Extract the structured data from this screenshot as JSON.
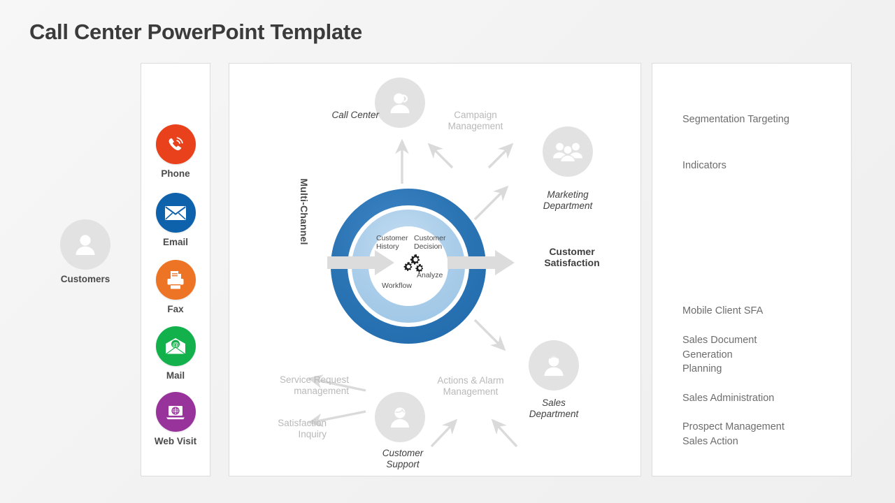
{
  "page": {
    "title": "Call Center PowerPoint Template",
    "background_color": "#f4f4f4",
    "panel_border_color": "#dcdcdc"
  },
  "customers": {
    "label": "Customers",
    "icon": "person-avatar-icon"
  },
  "channels": {
    "vertical_label": "Multi-Channel",
    "items": [
      {
        "label": "Phone",
        "icon": "phone-ringing-icon",
        "color": "#e8411b"
      },
      {
        "label": "Email",
        "icon": "envelope-icon",
        "color": "#0e62ab"
      },
      {
        "label": "Fax",
        "icon": "printer-fax-icon",
        "color": "#ec7424"
      },
      {
        "label": "Mail",
        "icon": "at-envelope-icon",
        "color": "#13b14b"
      },
      {
        "label": "Web Visit",
        "icon": "laptop-globe-icon",
        "color": "#99339c"
      }
    ]
  },
  "diagram": {
    "ring": {
      "outer_color": "#2b74b4",
      "inner_color": "#a8cce9",
      "core_words": [
        "Customer History",
        "Customer Decision",
        "Analyze",
        "Workflow"
      ],
      "word_history": "Customer History",
      "word_decision": "Customer Decision",
      "word_analyze": "Analyze",
      "word_workflow": "Workflow",
      "gears_icon": "gears-icon",
      "arrow_in_icon": "block-arrow-right-icon",
      "arrow_out_icon": "block-arrow-right-icon"
    },
    "nodes": {
      "call_center": {
        "label": "Call Center",
        "icon": "headset-agent-icon"
      },
      "campaign_management": {
        "label": "Campaign\nManagement"
      },
      "campaign_line1": "Campaign",
      "campaign_line2": "Management",
      "marketing_department": {
        "label": "Marketing\nDepartment",
        "icon": "people-group-icon"
      },
      "marketing_line1": "Marketing",
      "marketing_line2": "Department",
      "customer_satisfaction": {
        "line1": "Customer",
        "line2": "Satisfaction"
      },
      "sales_department": {
        "icon": "person-avatar-icon"
      },
      "sales_line1": "Sales",
      "sales_line2": "Department",
      "customer_support": {
        "icon": "support-agent-icon"
      },
      "support_line1": "Customer",
      "support_line2": "Support",
      "actions_line1": "Actions & Alarm",
      "actions_line2": "Management",
      "service_line1": "Service  Request",
      "service_line2": "management",
      "inquiry_line1": "Satisfaction",
      "inquiry_line2": "Inquiry"
    }
  },
  "right_panel": {
    "items": [
      "Segmentation Targeting",
      "Indicators",
      "Mobile Client SFA",
      "Sales Document\nGeneration\nPlanning",
      "Sales Administration",
      "Prospect Management\nSales Action"
    ],
    "item_0": "Segmentation Targeting",
    "item_1": "Indicators",
    "item_2": "Mobile Client SFA",
    "item_3_l1": "Sales Document",
    "item_3_l2": "Generation",
    "item_3_l3": "Planning",
    "item_4": "Sales Administration",
    "item_5_l1": "Prospect Management",
    "item_5_l2": "Sales Action"
  }
}
